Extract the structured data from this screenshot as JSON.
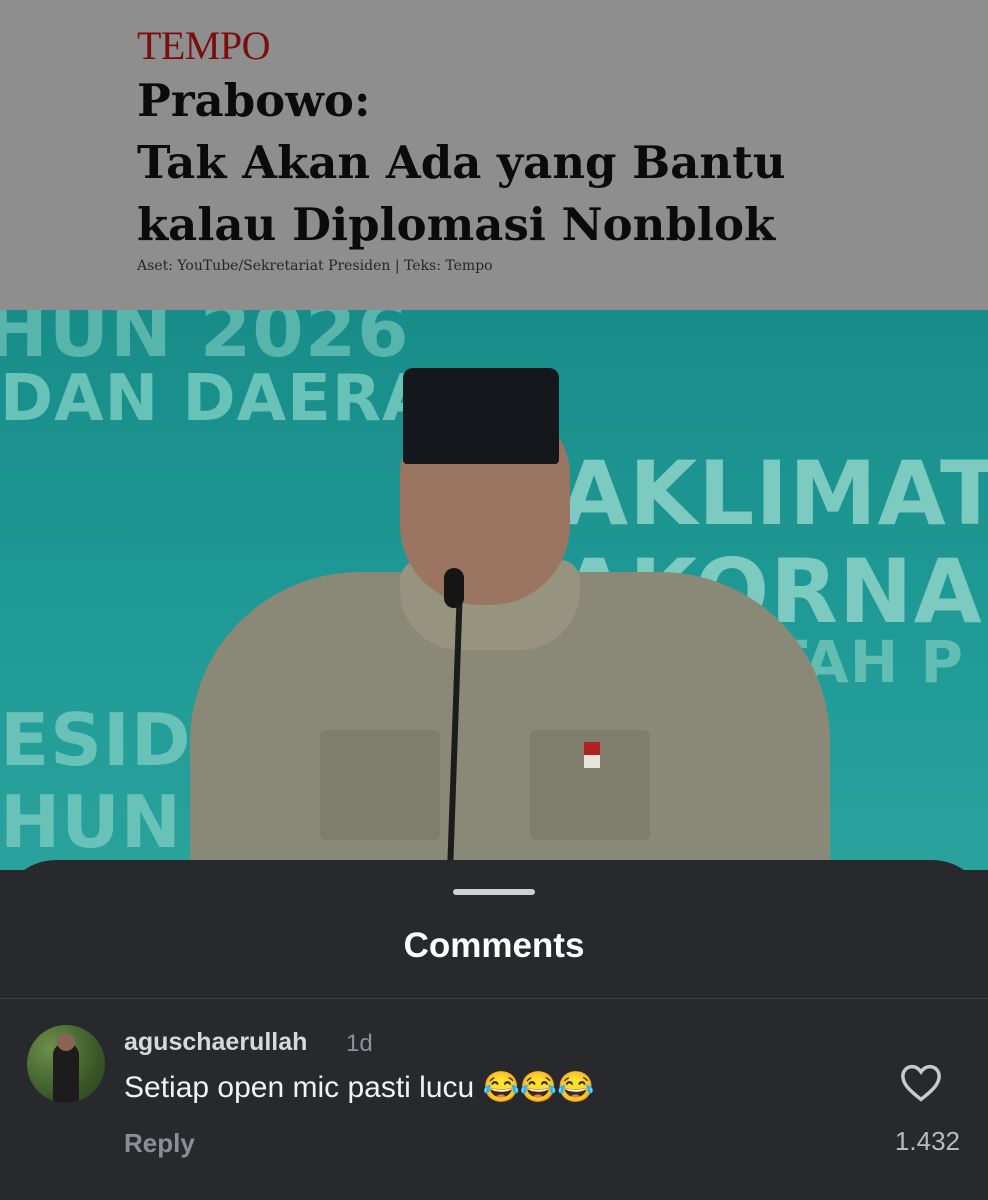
{
  "article": {
    "brand": "TEMPO",
    "headline_lines": [
      "Prabowo:",
      "Tak Akan Ada yang Bantu",
      "kalau Diplomasi Nonblok"
    ],
    "credit": "Aset: YouTube/Sekretariat Presiden | Teks: Tempo"
  },
  "video": {
    "background_text": [
      "HUN 2026",
      "DAN DAERA",
      "AKLIMAT",
      "AKORNAS",
      "RINTAH P",
      "ESIDE",
      "HUN"
    ]
  },
  "comments_sheet": {
    "title": "Comments",
    "comments": [
      {
        "username": "aguschaerullah",
        "time": "1d",
        "text": "Setiap open mic pasti lucu 😂😂😂",
        "reply_label": "Reply",
        "like_count": "1.432",
        "like_icon": "heart-outline-icon"
      }
    ]
  },
  "colors": {
    "sheet_bg": "#27292d",
    "brand_red": "#7a0d0d",
    "teal_bg": "#1f9a96"
  }
}
